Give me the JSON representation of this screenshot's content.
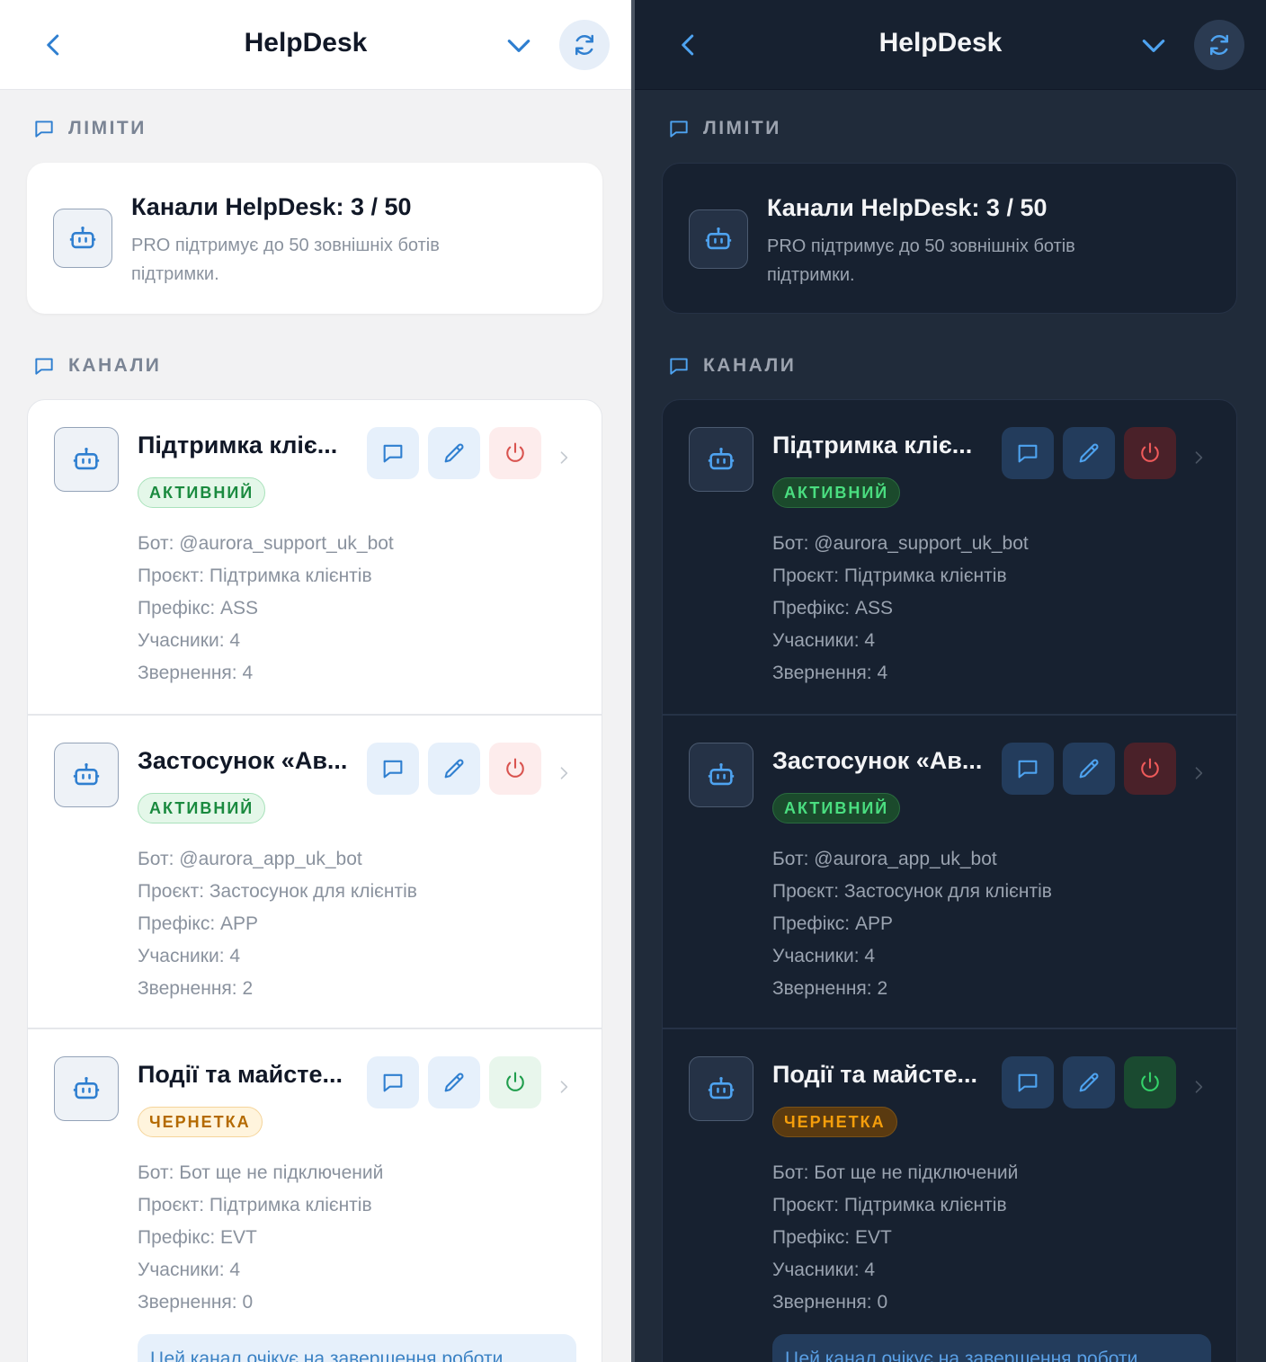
{
  "header": {
    "title": "HelpDesk"
  },
  "limits": {
    "label": "ЛІМІТИ",
    "title": "Канали HelpDesk: 3 / 50",
    "description": "PRO підтримує до 50 зовнішніх ботів підтримки."
  },
  "channels_section": {
    "label": "КАНАЛИ"
  },
  "channels": [
    {
      "name": "Підтримка клiє...",
      "status": "АКТИВНИЙ",
      "bot": "Бот: @aurora_support_uk_bot",
      "project": "Проєкт: Підтримка клієнтів",
      "prefix": "Префікс: ASS",
      "members": "Учасники: 4",
      "requests": "Звернення: 4"
    },
    {
      "name": "Застосунок «Ав...",
      "status": "АКТИВНИЙ",
      "bot": "Бот: @aurora_app_uk_bot",
      "project": "Проєкт: Застосунок для клієнтів",
      "prefix": "Префікс: APP",
      "members": "Учасники: 4",
      "requests": "Звернення: 2"
    },
    {
      "name": "Події та майсте...",
      "status": "ЧЕРНЕТКА",
      "bot": "Бот: Бот ще не підключений",
      "project": "Проєкт: Підтримка клієнтів",
      "prefix": "Префікс: EVT",
      "members": "Учасники: 4",
      "requests": "Звернення: 0"
    }
  ],
  "note": "Цей канал очікує на завершення роботи",
  "icons": {
    "back": "chevron-left-icon",
    "collapse": "chevron-down-icon",
    "refresh": "refresh-icon",
    "section": "message-square-icon",
    "bot": "bot-icon",
    "message": "message-square-icon",
    "edit": "pencil-icon",
    "power": "power-icon",
    "open": "chevron-right-icon"
  },
  "colors": {
    "accent": "#2f7fd0",
    "active_green": "#1a8a3f",
    "draft_amber": "#b46a00",
    "danger_red": "#d9534f",
    "dark_bg": "#202b3a"
  }
}
